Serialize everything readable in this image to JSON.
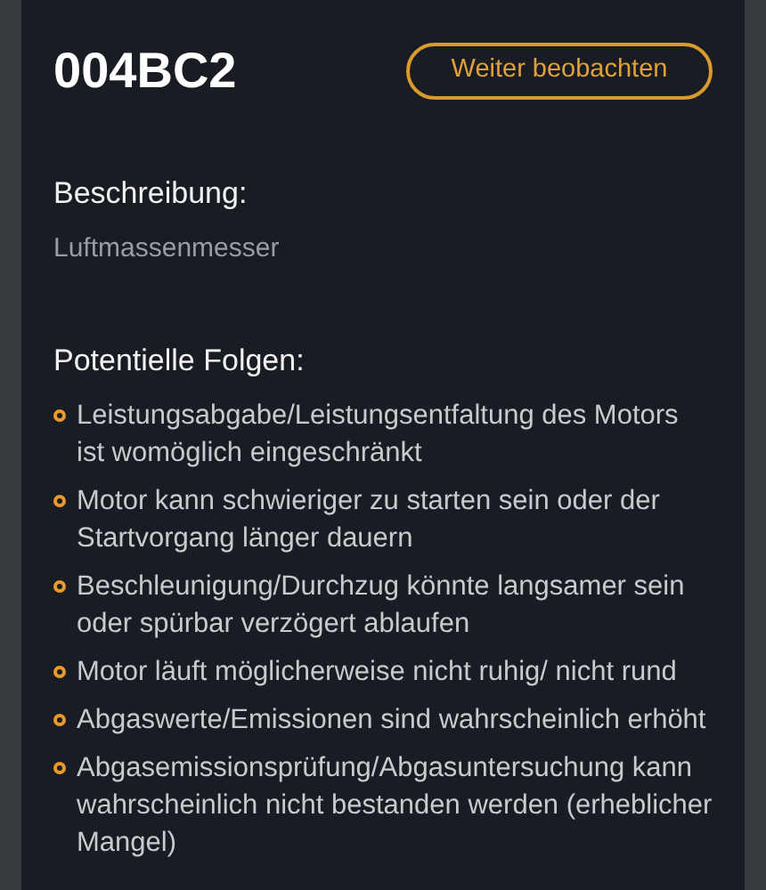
{
  "code": "004BC2",
  "action_button": {
    "label": "Weiter beobachten"
  },
  "description": {
    "heading": "Beschreibung:",
    "text": "Luftmassenmesser"
  },
  "consequences": {
    "heading": "Potentielle Folgen:",
    "items": [
      "Leistungsabgabe/Leistungsentfaltung des Motors ist womöglich eingeschränkt",
      "Motor kann schwieriger zu starten sein oder der Startvorgang länger dauern",
      "Beschleunigung/Durchzug könnte langsamer sein oder spürbar verzögert ablaufen",
      "Motor läuft möglicherweise nicht ruhig/ nicht rund",
      "Abgaswerte/Emissionen sind wahrscheinlich erhöht",
      "Abgasemissionsprüfung/Abgasuntersuchung kann wahrscheinlich nicht bestanden werden (erheblicher Mangel)"
    ]
  }
}
